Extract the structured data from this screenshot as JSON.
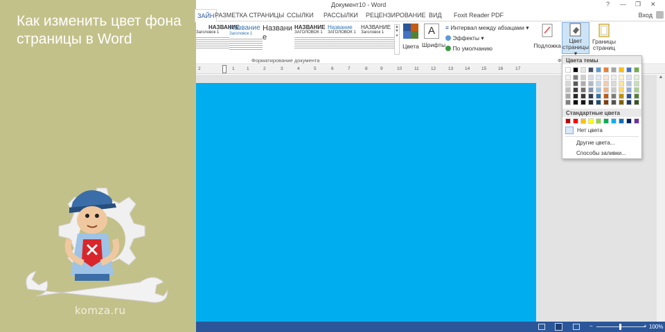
{
  "headline": "Как изменить цвет фона страницы в Word",
  "site": "komza.ru",
  "window": {
    "title": "Документ10 - Word",
    "signin": "Вход",
    "help": "?",
    "minimize": "—",
    "restore": "❐",
    "close": "✕"
  },
  "tabs": [
    {
      "label": "ЗАЙН",
      "active": true
    },
    {
      "label": "РАЗМЕТКА СТРАНИЦЫ"
    },
    {
      "label": "ССЫЛКИ"
    },
    {
      "label": "РАССЫЛКИ"
    },
    {
      "label": "РЕЦЕНЗИРОВАНИЕ"
    },
    {
      "label": "ВИД"
    },
    {
      "label": "Foxit Reader PDF"
    }
  ],
  "ribbon": {
    "styles": [
      {
        "heading": "НАЗВАНИЕ",
        "sub": "Заголовок 1"
      },
      {
        "heading": "Название",
        "sub": "Заголовок 1"
      },
      {
        "heading": "Названи е",
        "sub": ""
      },
      {
        "heading": "НАЗВАНИЕ",
        "sub": "ЗАГОЛОВОК 1"
      },
      {
        "heading": "Название",
        "sub": "ЗАГОЛОВОК 1"
      },
      {
        "heading": "НАЗВАНИЕ",
        "sub": "Заголовок 1"
      }
    ],
    "group_label": "Форматирование документа",
    "colors": "Цвета",
    "fonts": "Шрифты",
    "paragraph_spacing": "Интервал между абзацами",
    "effects": "Эффекты",
    "set_default": "По умолчанию",
    "watermark": "Подложка",
    "page_color_1": "Цвет",
    "page_color_2": "страницы",
    "page_borders_1": "Границы",
    "page_borders_2": "страниц",
    "group_label_right": "Ф"
  },
  "ruler": {
    "numbers": [
      "2",
      "1",
      "1",
      "2",
      "3",
      "4",
      "5",
      "6",
      "7",
      "8",
      "9",
      "10",
      "11",
      "12",
      "13",
      "14",
      "15",
      "16",
      "17"
    ]
  },
  "page_background": "#00aeef",
  "dropdown": {
    "theme_colors_label": "Цвета темы",
    "theme_top": [
      "#ffffff",
      "#000000",
      "#e7e6e6",
      "#44546a",
      "#5b9bd5",
      "#ed7d31",
      "#a5a5a5",
      "#ffc000",
      "#4472c4",
      "#70ad47"
    ],
    "theme_shades": [
      [
        "#f2f2f2",
        "#7f7f7f",
        "#d0cece",
        "#d6dce4",
        "#deebf6",
        "#fbe5d5",
        "#ededed",
        "#fff2cc",
        "#d9e2f3",
        "#e2efd9"
      ],
      [
        "#d8d8d8",
        "#595959",
        "#aeabab",
        "#adb9ca",
        "#bdd7ee",
        "#f7cbac",
        "#dbdbdb",
        "#fee599",
        "#b4c6e7",
        "#c5e0b3"
      ],
      [
        "#bfbfbf",
        "#3f3f3f",
        "#757070",
        "#8496b0",
        "#9cc3e5",
        "#f4b183",
        "#c9c9c9",
        "#ffd965",
        "#8eaadb",
        "#a8d08d"
      ],
      [
        "#a5a5a5",
        "#262626",
        "#3a3838",
        "#323f4f",
        "#2e75b5",
        "#c45911",
        "#7b7b7b",
        "#bf9000",
        "#2f5496",
        "#538135"
      ],
      [
        "#7f7f7f",
        "#0c0c0c",
        "#161616",
        "#222a35",
        "#1e4e79",
        "#833c0b",
        "#525252",
        "#7f6000",
        "#1f3864",
        "#375623"
      ]
    ],
    "standard_label": "Стандартные цвета",
    "standard": [
      "#c00000",
      "#ff0000",
      "#ffc000",
      "#ffff00",
      "#92d050",
      "#00b050",
      "#00b0f0",
      "#0070c0",
      "#002060",
      "#7030a0"
    ],
    "no_color": "Нет цвета",
    "more_colors": "Другие цвета...",
    "fill_effects": "Способы заливки..."
  },
  "status": {
    "zoom": "100%",
    "minus": "−",
    "plus": "+"
  }
}
